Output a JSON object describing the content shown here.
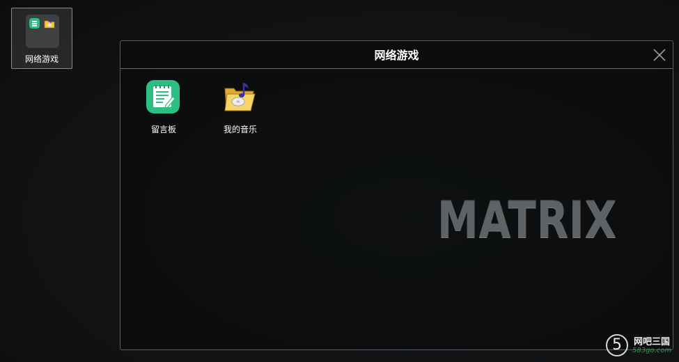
{
  "desktop": {
    "folder_label": "网络游戏"
  },
  "window": {
    "title": "网络游戏",
    "apps": [
      {
        "label": "留言板",
        "icon": "notepad-icon"
      },
      {
        "label": "我的音乐",
        "icon": "music-folder-icon"
      }
    ]
  },
  "watermark": {
    "logo_text": "MATRIX",
    "site_badge": "5",
    "site_name": "网吧三国",
    "site_url": "583go.com"
  },
  "colors": {
    "notepad_green": "#2bbf82",
    "folder_yellow": "#f3c44a",
    "note_purple": "#3b2fb0",
    "site_green": "#2c9c4a"
  }
}
